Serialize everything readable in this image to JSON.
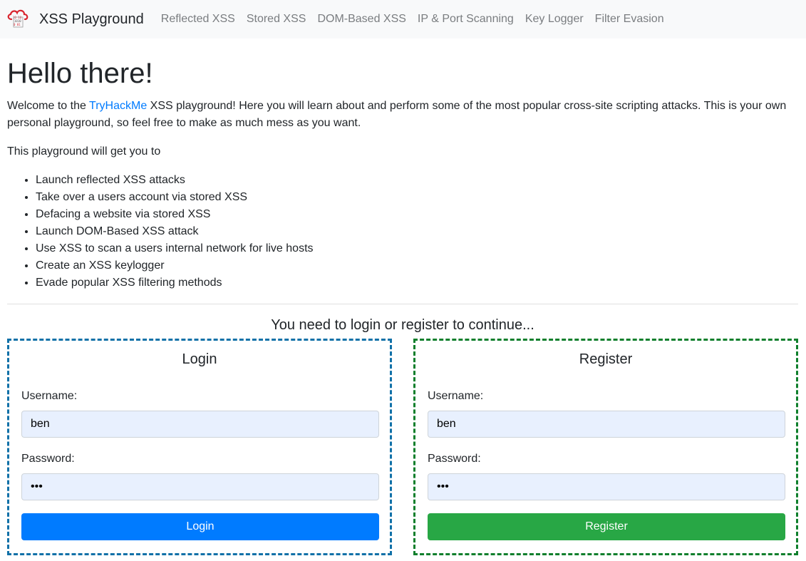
{
  "navbar": {
    "brand": "XSS Playground",
    "links": [
      "Reflected XSS",
      "Stored XSS",
      "DOM-Based XSS",
      "IP & Port Scanning",
      "Key Logger",
      "Filter Evasion"
    ]
  },
  "main": {
    "heading": "Hello there!",
    "intro_before": "Welcome to the ",
    "intro_link": "TryHackMe",
    "intro_after": " XSS playground! Here you will learn about and perform some of the most popular cross-site scripting attacks. This is your own personal playground, so feel free to make as much mess as you want.",
    "list_intro": "This playground will get you to",
    "items": [
      "Launch reflected XSS attacks",
      "Take over a users account via stored XSS",
      "Defacing a website via stored XSS",
      "Launch DOM-Based XSS attack",
      "Use XSS to scan a users internal network for live hosts",
      "Create an XSS keylogger",
      "Evade popular XSS filtering methods"
    ],
    "prompt": "You need to login or register to continue..."
  },
  "login": {
    "title": "Login",
    "username_label": "Username:",
    "username_value": "ben",
    "password_label": "Password:",
    "password_value": "ben",
    "button": "Login"
  },
  "register": {
    "title": "Register",
    "username_label": "Username:",
    "username_value": "ben",
    "password_label": "Password:",
    "password_value": "ben",
    "button": "Register"
  },
  "colors": {
    "login_border": "#1171a8",
    "register_border": "#0f7f2c",
    "primary": "#007bff",
    "success": "#28a745",
    "logo": "#d9232d"
  },
  "icons": {
    "brand": "cloud-binary-logo-icon"
  }
}
